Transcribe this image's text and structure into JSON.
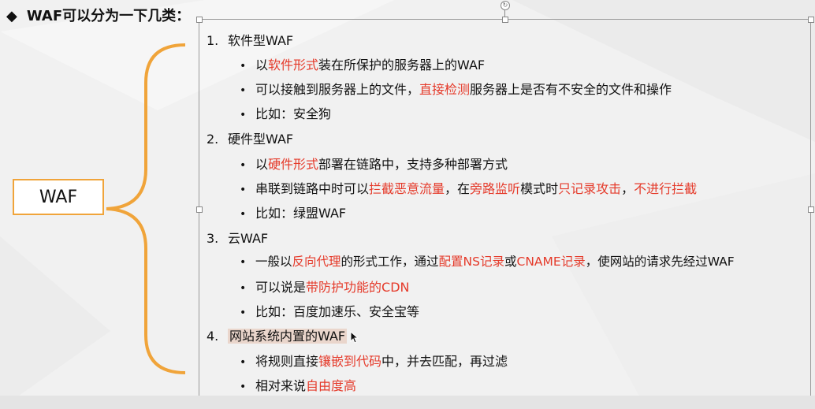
{
  "heading": {
    "marker": "◆",
    "text": "WAF可以分为一下几类："
  },
  "waf_box": {
    "label": "WAF"
  },
  "items": [
    {
      "number": "1.",
      "title": "软件型WAF",
      "bullets": [
        [
          {
            "t": "以"
          },
          {
            "t": "软件形式",
            "red": true
          },
          {
            "t": "装在所保护的服务器上的WAF"
          }
        ],
        [
          {
            "t": "可以接触到服务器上的文件，"
          },
          {
            "t": "直接检测",
            "red": true
          },
          {
            "t": "服务器上是否有不安全的文件和操作"
          }
        ],
        [
          {
            "t": "比如：安全狗"
          }
        ]
      ]
    },
    {
      "number": "2.",
      "title": "硬件型WAF",
      "bullets": [
        [
          {
            "t": "以"
          },
          {
            "t": "硬件形式",
            "red": true
          },
          {
            "t": "部署在链路中，支持多种部署方式"
          }
        ],
        [
          {
            "t": "串联到链路中时可以"
          },
          {
            "t": "拦截恶意流量",
            "red": true
          },
          {
            "t": "，在"
          },
          {
            "t": "旁路监听",
            "red": true
          },
          {
            "t": "模式时"
          },
          {
            "t": "只记录攻击",
            "red": true
          },
          {
            "t": "，"
          },
          {
            "t": "不进行拦截",
            "red": true
          }
        ],
        [
          {
            "t": "比如：绿盟WAF"
          }
        ]
      ]
    },
    {
      "number": "3.",
      "title": "云WAF",
      "bullets": [
        [
          {
            "t": "一般以"
          },
          {
            "t": "反向代理",
            "red": true
          },
          {
            "t": "的形式工作，通过"
          },
          {
            "t": "配置NS记录",
            "red": true
          },
          {
            "t": "或"
          },
          {
            "t": "CNAME记录",
            "red": true
          },
          {
            "t": "，使网站的请求先经过WAF"
          }
        ],
        [
          {
            "t": "可以说是"
          },
          {
            "t": "带防护功能的CDN",
            "red": true
          }
        ],
        [
          {
            "t": "比如：百度加速乐、安全宝等"
          }
        ]
      ]
    },
    {
      "number": "4.",
      "title": "网站系统内置的WAF",
      "bullets": [
        [
          {
            "t": "将规则直接"
          },
          {
            "t": "镶嵌到代码",
            "red": true
          },
          {
            "t": "中，并去匹配，再过滤"
          }
        ],
        [
          {
            "t": "相对来说"
          },
          {
            "t": "自由度高",
            "red": true
          }
        ]
      ]
    }
  ],
  "colors": {
    "accent_red": "#e53a2a",
    "brace_orange": "#f0a43a",
    "selection_highlight": "#ead6cc"
  }
}
